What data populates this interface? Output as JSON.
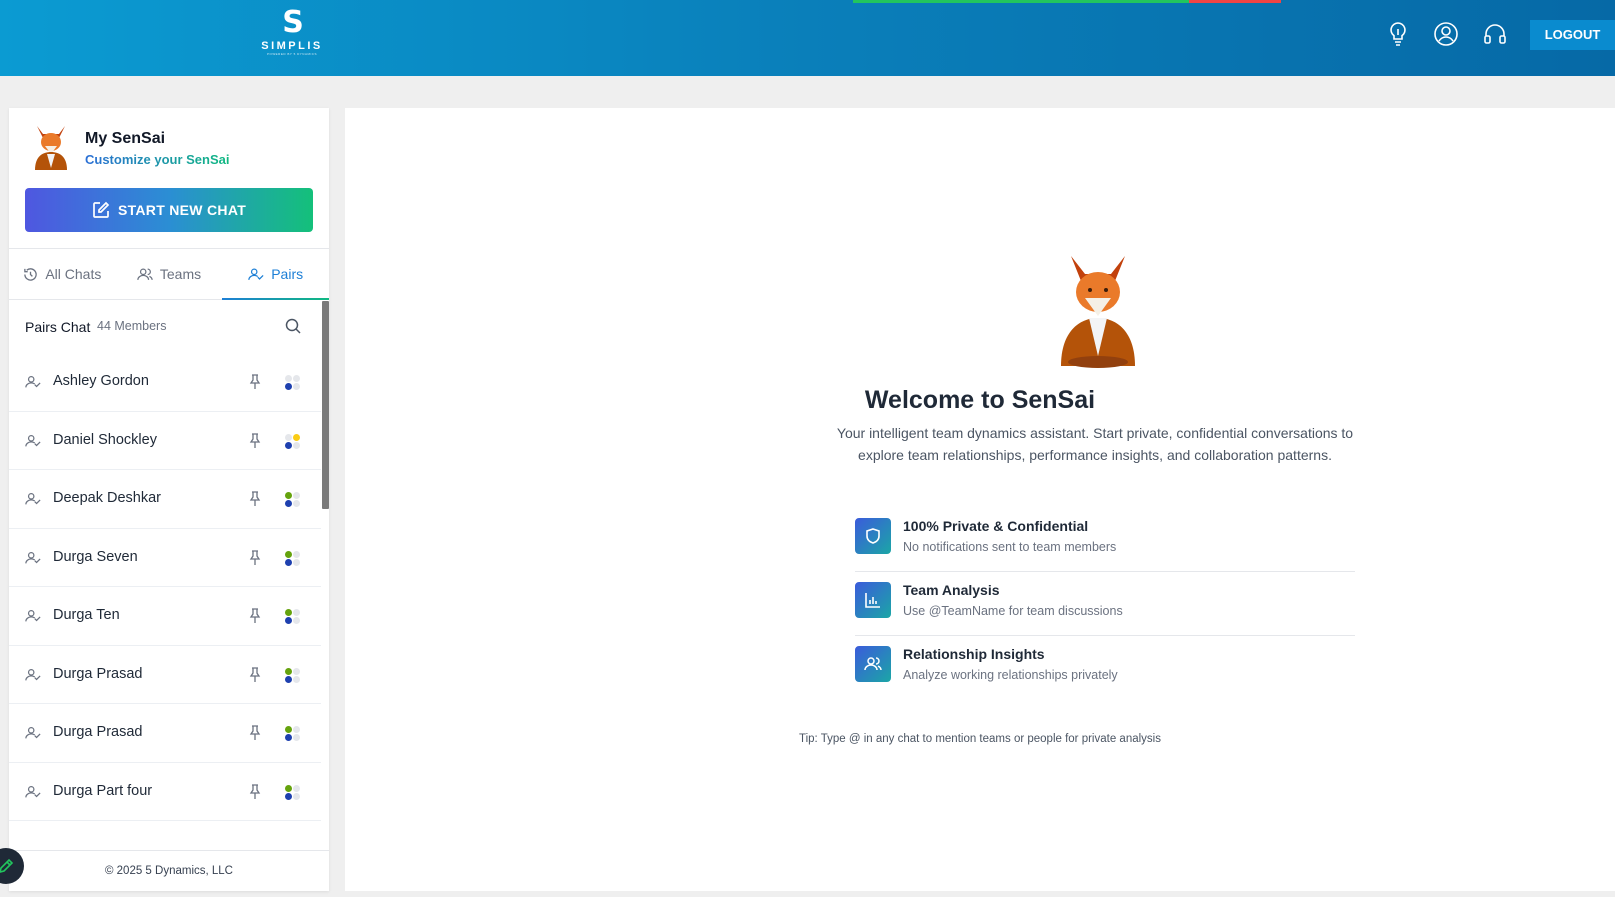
{
  "header": {
    "logo_text": "SIMPLIS",
    "logo_subtext": "POWERED BY 5 DYNAMICS",
    "logout_label": "LOGOUT",
    "icons": [
      "lightbulb-icon",
      "user-circle-icon",
      "headset-icon"
    ]
  },
  "sidebar": {
    "title": "My SenSai",
    "customize_label": "Customize your SenSai",
    "start_chat_label": "START NEW CHAT",
    "tabs": [
      {
        "label": "All Chats",
        "icon": "history-icon"
      },
      {
        "label": "Teams",
        "icon": "users-icon"
      },
      {
        "label": "Pairs",
        "icon": "user-check-icon",
        "active": true
      }
    ],
    "list_title": "Pairs Chat",
    "member_count": "44 Members",
    "members": [
      {
        "name": "Ashley Gordon",
        "dots": [
          "#e5e7eb",
          "#e5e7eb",
          "#1e40af",
          "#e5e7eb"
        ]
      },
      {
        "name": "Daniel Shockley",
        "dots": [
          "#e5e7eb",
          "#facc15",
          "#1e40af",
          "#e5e7eb"
        ]
      },
      {
        "name": "Deepak Deshkar",
        "dots": [
          "#65a30d",
          "#e5e7eb",
          "#1e40af",
          "#e5e7eb"
        ]
      },
      {
        "name": "Durga Seven",
        "dots": [
          "#65a30d",
          "#e5e7eb",
          "#1e40af",
          "#e5e7eb"
        ]
      },
      {
        "name": "Durga Ten",
        "dots": [
          "#65a30d",
          "#e5e7eb",
          "#1e40af",
          "#e5e7eb"
        ]
      },
      {
        "name": "Durga Prasad",
        "dots": [
          "#65a30d",
          "#e5e7eb",
          "#1e40af",
          "#e5e7eb"
        ]
      },
      {
        "name": "Durga Prasad",
        "dots": [
          "#65a30d",
          "#e5e7eb",
          "#1e40af",
          "#e5e7eb"
        ]
      },
      {
        "name": "Durga Part four",
        "dots": [
          "#65a30d",
          "#e5e7eb",
          "#1e40af",
          "#e5e7eb"
        ]
      },
      {
        "name": "",
        "dots": [
          "#65a30d",
          "#e5e7eb",
          "#1e40af",
          "#e5e7eb"
        ]
      }
    ],
    "footer": "© 2025 5 Dynamics, LLC"
  },
  "main": {
    "title": "Welcome to SenSai",
    "subtitle": "Your intelligent team dynamics assistant. Start private, confidential conversations to explore team relationships, performance insights, and collaboration patterns.",
    "features": [
      {
        "title": "100% Private & Confidential",
        "desc": "No notifications sent to team members",
        "icon": "shield-icon"
      },
      {
        "title": "Team Analysis",
        "desc": "Use @TeamName for team discussions",
        "icon": "bar-chart-icon"
      },
      {
        "title": "Relationship Insights",
        "desc": "Analyze working relationships privately",
        "icon": "users-icon"
      }
    ],
    "tip": "Tip: Type @ in any chat to mention teams or people for private analysis"
  },
  "colors": {
    "header_start": "#0b9bd2",
    "header_end": "#0669a6",
    "accent_blue": "#1d7fd6",
    "accent_green": "#10b981"
  }
}
